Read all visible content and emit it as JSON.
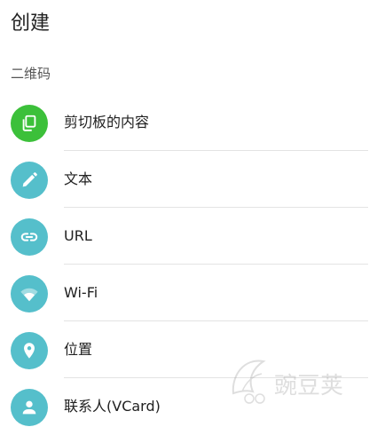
{
  "page": {
    "title": "创建",
    "section_label": "二维码"
  },
  "items": [
    {
      "label": "剪切板的内容",
      "icon": "clipboard-copy-icon",
      "color": "#3cc03a"
    },
    {
      "label": "文本",
      "icon": "pencil-icon",
      "color": "#55bfcb"
    },
    {
      "label": "URL",
      "icon": "link-icon",
      "color": "#55bfcb"
    },
    {
      "label": "Wi-Fi",
      "icon": "wifi-icon",
      "color": "#55bfcb"
    },
    {
      "label": "位置",
      "icon": "location-pin-icon",
      "color": "#55bfcb"
    },
    {
      "label": "联系人(VCard)",
      "icon": "person-icon",
      "color": "#55bfcb"
    }
  ],
  "colors": {
    "accent_green": "#3cc03a",
    "accent_teal": "#55bfcb"
  },
  "watermark": {
    "text": "豌豆荚",
    "icon": "wandoujia-logo-icon"
  }
}
